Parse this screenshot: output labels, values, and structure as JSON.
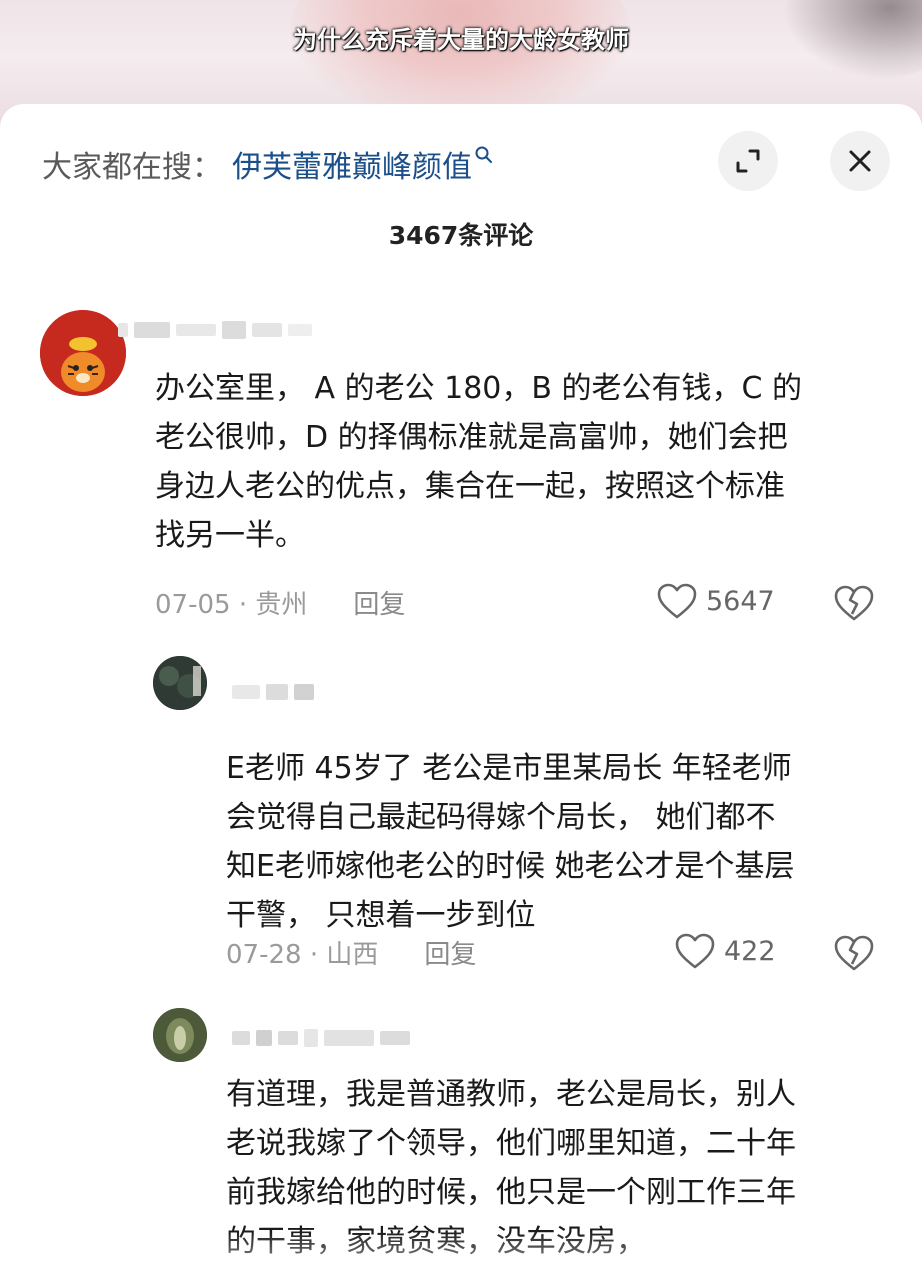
{
  "video": {
    "caption": "为什么充斥着大量的大龄女教师"
  },
  "header": {
    "search_prefix": "大家都在搜：",
    "search_term": "伊芙蕾雅巅峰颜值",
    "search_icon": "search-icon",
    "expand_icon": "expand-icon",
    "close_icon": "close-icon"
  },
  "comments_count": "3467条评论",
  "comments": [
    {
      "text_lines": [
        "办公室里， A 的老公 180，B 的老公有钱，C 的",
        "老公很帅，D 的择偶标准就是高富帅，她们会把",
        "身边人老公的优点，集合在一起，按照这个标准",
        "找另一半。"
      ],
      "date_location": "07-05 · 贵州",
      "reply_label": "回复",
      "likes": "5647"
    },
    {
      "text_lines": [
        "E老师 45岁了 老公是市里某局长   年轻老师",
        "会觉得自己最起码得嫁个局长，  她们都不",
        "知E老师嫁他老公的时候 她老公才是个基层",
        "干警， 只想着一步到位"
      ],
      "date_location": "07-28 · 山西",
      "reply_label": "回复",
      "likes": "422"
    },
    {
      "text_lines": [
        "有道理，我是普通教师，老公是局长，别人",
        "老说我嫁了个领导，他们哪里知道，二十年",
        "前我嫁给他的时候，他只是一个刚工作三年",
        "的干事，家境贫寒，没车没房，"
      ]
    }
  ],
  "colors": {
    "search_term": "#1b4f8a",
    "meta": "#9a9a9a",
    "avatar_red": "#c62a1f"
  }
}
